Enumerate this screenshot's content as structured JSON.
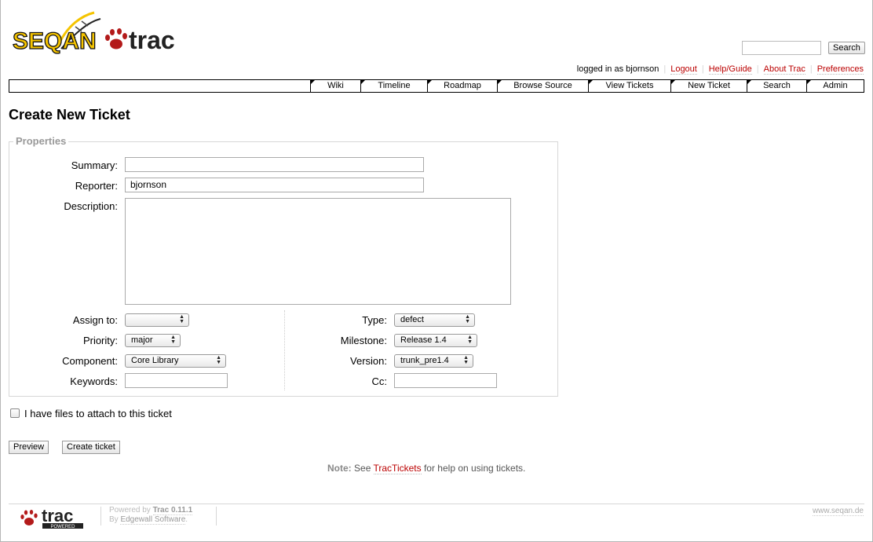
{
  "header": {
    "logo_text": "SEQAN",
    "logo_trac": "trac",
    "search_button": "Search",
    "search_value": ""
  },
  "metanav": {
    "logged_in": "logged in as bjornson",
    "logout": "Logout",
    "help": "Help/Guide",
    "about": "About Trac",
    "preferences": "Preferences"
  },
  "mainnav": [
    "Wiki",
    "Timeline",
    "Roadmap",
    "Browse Source",
    "View Tickets",
    "New Ticket",
    "Search",
    "Admin"
  ],
  "page_title": "Create New Ticket",
  "properties": {
    "legend": "Properties",
    "summary_label": "Summary:",
    "summary_value": "",
    "reporter_label": "Reporter:",
    "reporter_value": "bjornson",
    "description_label": "Description:",
    "assign_label": "Assign to:",
    "assign_value": "",
    "priority_label": "Priority:",
    "priority_value": "major",
    "component_label": "Component:",
    "component_value": "Core Library",
    "keywords_label": "Keywords:",
    "keywords_value": "",
    "type_label": "Type:",
    "type_value": "defect",
    "milestone_label": "Milestone:",
    "milestone_value": "Release 1.4",
    "version_label": "Version:",
    "version_value": "trunk_pre1.4",
    "cc_label": "Cc:",
    "cc_value": ""
  },
  "attach_label": "I have files to attach to this ticket",
  "buttons": {
    "preview": "Preview",
    "create": "Create ticket"
  },
  "note": {
    "prefix": "Note:",
    "see": "See",
    "link": "TracTickets",
    "suffix": "for help on using tickets."
  },
  "footer": {
    "logo_text": "trac",
    "logo_badge": "POWERED",
    "powered_by": "Powered by",
    "trac_version": "Trac 0.11.1",
    "by": "By",
    "edgewall": "Edgewall Software",
    "site": "www.seqan.de"
  },
  "colors": {
    "link": "#bb0000",
    "seqan_yellow": "#f5c400",
    "paw_red": "#b31a1a"
  }
}
